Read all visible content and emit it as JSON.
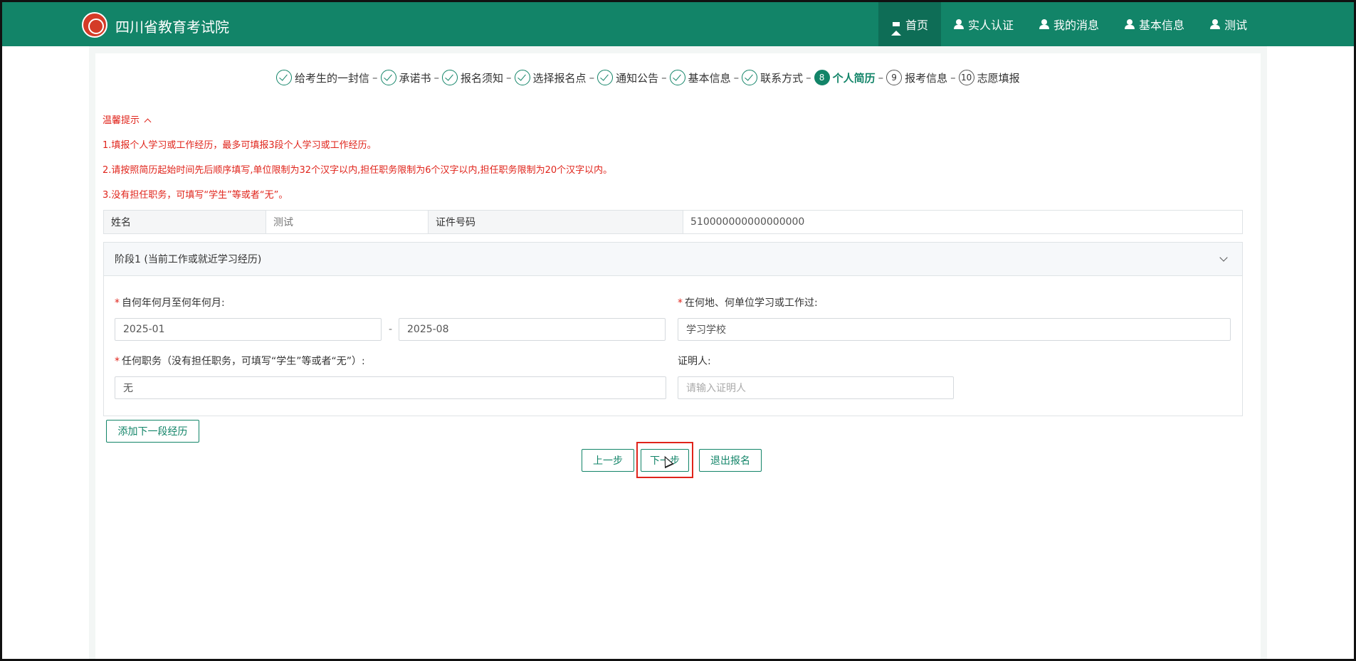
{
  "header": {
    "brand": "四川省教育考试院",
    "nav": [
      {
        "label": "首页",
        "icon": "home-icon",
        "active": true
      },
      {
        "label": "实人认证",
        "icon": "user-icon"
      },
      {
        "label": "我的消息",
        "icon": "user-icon"
      },
      {
        "label": "基本信息",
        "icon": "user-icon"
      },
      {
        "label": "测试",
        "icon": "user-icon"
      }
    ]
  },
  "steps": [
    {
      "label": "给考生的一封信",
      "status": "done"
    },
    {
      "label": "承诺书",
      "status": "done"
    },
    {
      "label": "报名须知",
      "status": "done"
    },
    {
      "label": "选择报名点",
      "status": "done"
    },
    {
      "label": "通知公告",
      "status": "done"
    },
    {
      "label": "基本信息",
      "status": "done"
    },
    {
      "label": "联系方式",
      "status": "done"
    },
    {
      "label": "个人简历",
      "number": "8",
      "status": "current"
    },
    {
      "label": "报考信息",
      "number": "9",
      "status": "todo"
    },
    {
      "label": "志愿填报",
      "number": "10",
      "status": "todo"
    }
  ],
  "tips": {
    "title": "温馨提示",
    "items": [
      "1.填报个人学习或工作经历，最多可填报3段个人学习或工作经历。",
      "2.请按照简历起始时间先后顺序填写,单位限制为32个汉字以内,担任职务限制为6个汉字以内,担任职务限制为20个汉字以内。",
      "3.没有担任职务，可填写“学生”等或者“无”。"
    ]
  },
  "info": {
    "name_label": "姓名",
    "name_value": "测试",
    "id_label": "证件号码",
    "id_value": "510000000000000000"
  },
  "stage": {
    "title": "阶段1 (当前工作或就近学习经历)",
    "period_label": "自何年何月至何年何月:",
    "start": "2025-01",
    "dash": "-",
    "end": "2025-08",
    "place_label": "在何地、何单位学习或工作过:",
    "place": "学习学校",
    "position_label": "任何职务（没有担任职务，可填写“学生”等或者“无”）:",
    "position": "无",
    "witness_label": "证明人:",
    "witness_placeholder": "请输入证明人"
  },
  "buttons": {
    "add": "添加下一段经历",
    "prev": "上一步",
    "next": "下一步",
    "exit": "退出报名"
  },
  "colors": {
    "brand": "#128468",
    "alert": "#e0241b"
  }
}
